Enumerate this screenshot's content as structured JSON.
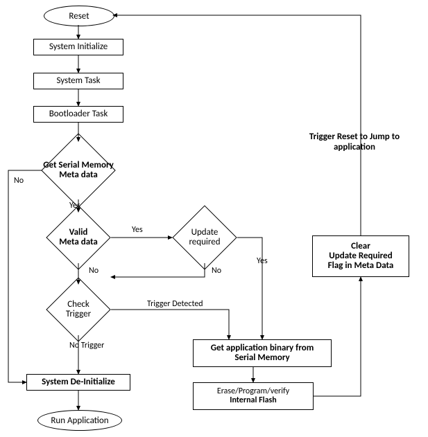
{
  "nodes": {
    "reset": "Reset",
    "sys_init": "System Initialize",
    "sys_task": "System Task",
    "boot_task": "Bootloader Task",
    "get_meta": "Get Serial Memory\nMeta data",
    "valid_meta": "Valid\nMeta data",
    "update_req": "Update\nrequired",
    "check_trigger": "Check\nTrigger",
    "sys_deinit": "System De-Initialize",
    "run_app": "Run Application",
    "get_app_bin": "Get application binary from\nSerial Memory",
    "flash_op": "Erase/Program/verify\nInternal Flash",
    "clear_flag": "Clear\nUpdate Required\nFlag in Meta Data",
    "trigger_reset": "Trigger Reset to Jump to\napplication"
  },
  "edges": {
    "yes1": "Yes",
    "no1": "No",
    "yes2": "Yes",
    "no2": "No",
    "yes3": "Yes",
    "no3": "No",
    "trig_detected": "Trigger Detected",
    "no_trigger": "No Trigger"
  },
  "chart_data": {
    "type": "flowchart",
    "nodes": [
      {
        "id": "reset",
        "shape": "terminator",
        "label": "Reset"
      },
      {
        "id": "sys_init",
        "shape": "process",
        "label": "System Initialize"
      },
      {
        "id": "sys_task",
        "shape": "process",
        "label": "System Task"
      },
      {
        "id": "boot_task",
        "shape": "process",
        "label": "Bootloader Task"
      },
      {
        "id": "get_meta",
        "shape": "decision",
        "label": "Get Serial Memory Meta data"
      },
      {
        "id": "valid_meta",
        "shape": "decision",
        "label": "Valid Meta data"
      },
      {
        "id": "update_req",
        "shape": "decision",
        "label": "Update required"
      },
      {
        "id": "check_trigger",
        "shape": "decision",
        "label": "Check Trigger"
      },
      {
        "id": "sys_deinit",
        "shape": "process",
        "label": "System De-Initialize"
      },
      {
        "id": "run_app",
        "shape": "terminator",
        "label": "Run Application"
      },
      {
        "id": "get_app_bin",
        "shape": "process",
        "label": "Get application binary from Serial Memory"
      },
      {
        "id": "flash_op",
        "shape": "process",
        "label": "Erase/Program/verify Internal Flash"
      },
      {
        "id": "clear_flag",
        "shape": "process",
        "label": "Clear Update Required Flag in Meta Data"
      },
      {
        "id": "trigger_reset",
        "shape": "label",
        "label": "Trigger Reset to Jump to application"
      }
    ],
    "edges": [
      {
        "from": "reset",
        "to": "sys_init"
      },
      {
        "from": "sys_init",
        "to": "sys_task"
      },
      {
        "from": "sys_task",
        "to": "boot_task"
      },
      {
        "from": "boot_task",
        "to": "get_meta"
      },
      {
        "from": "get_meta",
        "to": "valid_meta",
        "label": "Yes"
      },
      {
        "from": "get_meta",
        "to": "sys_deinit",
        "label": "No"
      },
      {
        "from": "valid_meta",
        "to": "update_req",
        "label": "Yes"
      },
      {
        "from": "valid_meta",
        "to": "check_trigger",
        "label": "No"
      },
      {
        "from": "update_req",
        "to": "check_trigger",
        "label": "No"
      },
      {
        "from": "update_req",
        "to": "get_app_bin",
        "label": "Yes"
      },
      {
        "from": "check_trigger",
        "to": "get_app_bin",
        "label": "Trigger Detected"
      },
      {
        "from": "check_trigger",
        "to": "sys_deinit",
        "label": "No Trigger"
      },
      {
        "from": "sys_deinit",
        "to": "run_app"
      },
      {
        "from": "get_app_bin",
        "to": "flash_op"
      },
      {
        "from": "flash_op",
        "to": "clear_flag"
      },
      {
        "from": "clear_flag",
        "to": "reset",
        "label": "Trigger Reset to Jump to application"
      }
    ]
  }
}
